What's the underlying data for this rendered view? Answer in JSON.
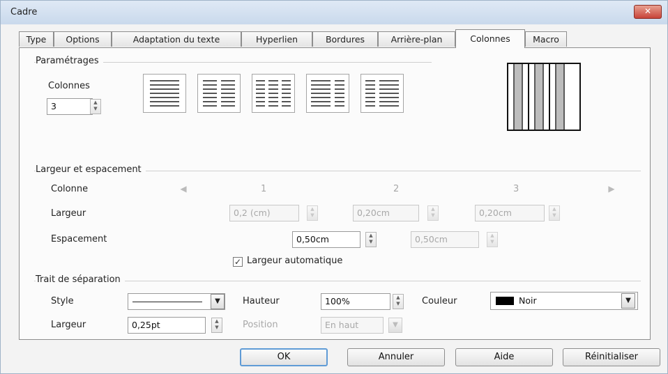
{
  "window": {
    "title": "Cadre",
    "close": "✕"
  },
  "tabs": [
    "Type",
    "Options",
    "Adaptation du texte",
    "Hyperlien",
    "Bordures",
    "Arrière-plan",
    "Colonnes",
    "Macro"
  ],
  "settings": {
    "section": "Paramétrages",
    "columns_label": "Colonnes",
    "columns_value": "3"
  },
  "width_spacing": {
    "section": "Largeur et espacement",
    "column_label": "Colonne",
    "column_numbers": [
      "1",
      "2",
      "3"
    ],
    "width_label": "Largeur",
    "width_values": [
      "0,2 (cm)",
      "0,20cm",
      "0,20cm"
    ],
    "spacing_label": "Espacement",
    "spacing_values": [
      "0,50cm",
      "0,50cm"
    ],
    "auto_width_label": "Largeur automatique",
    "auto_width_checked": true
  },
  "separator": {
    "section": "Trait de séparation",
    "style_label": "Style",
    "height_label": "Hauteur",
    "height_value": "100%",
    "color_label": "Couleur",
    "color_value": "Noir",
    "color_hex": "#000000",
    "width_label": "Largeur",
    "width_value": "0,25pt",
    "position_label": "Position",
    "position_value": "En haut"
  },
  "buttons": {
    "ok": "OK",
    "cancel": "Annuler",
    "help": "Aide",
    "reset": "Réinitialiser"
  }
}
